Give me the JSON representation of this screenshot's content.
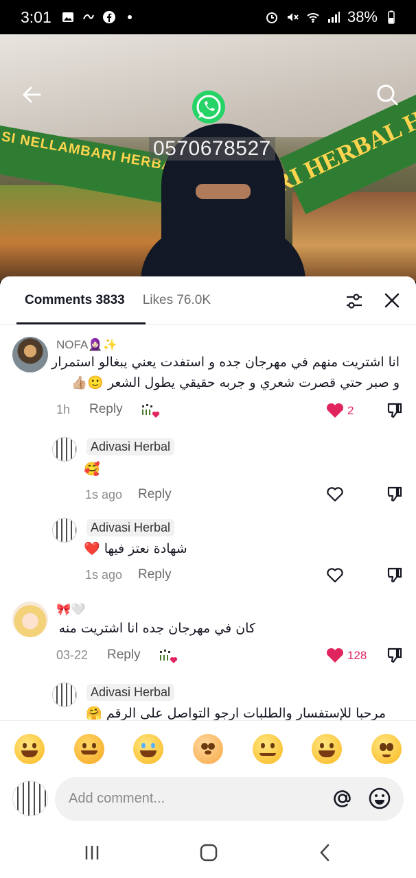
{
  "status": {
    "time": "3:01",
    "battery": "38%",
    "icons": [
      "gallery-icon",
      "link-icon",
      "facebook-icon",
      "dot-icon",
      "alarm-icon",
      "mute-icon",
      "wifi-icon",
      "signal-icon",
      "battery-icon"
    ]
  },
  "video": {
    "phone_overlay": "0570678527",
    "banner_left": "SI NELLAMBARI HERBAL HA",
    "banner_right": "RI HERBAL H"
  },
  "tabs": {
    "comments_label": "Comments 3833",
    "likes_label": "Likes 76.0K"
  },
  "comments": [
    {
      "username": "NOFA🧕🏻✨",
      "text_line1": "انا اشتريت منهم في مهرجان جده و استفدت يعني يبغالو استمرار",
      "text_line2": "و صبر حتي قصرت شعري و جربه حقيقي يطول الشعر 🙂👍🏼",
      "time": "1h",
      "reply": "Reply",
      "likes": "2"
    },
    {
      "username": "Adivasi Herbal",
      "text": "🥰",
      "time": "1s ago",
      "reply": "Reply"
    },
    {
      "username": "Adivasi Herbal",
      "text": "شهادة نعتز فيها ❤️",
      "time": "1s ago",
      "reply": "Reply"
    },
    {
      "username": "🎀🤍",
      "text": "كان في مهرجان جده انا اشتريت منه",
      "time": "03-22",
      "reply": "Reply",
      "likes": "128"
    },
    {
      "username": "Adivasi Herbal",
      "text": "مرحبا للإستفسار والطلبات ارجو التواصل على الرقم 🤗"
    }
  ],
  "emoji_bar": [
    "😁",
    "🥰",
    "😂",
    "😳",
    "😏",
    "😅",
    "🥺"
  ],
  "input": {
    "placeholder": "Add comment..."
  },
  "colors": {
    "like_red": "#e0245e",
    "text_primary": "#161823",
    "text_secondary": "#6b6b6b"
  }
}
